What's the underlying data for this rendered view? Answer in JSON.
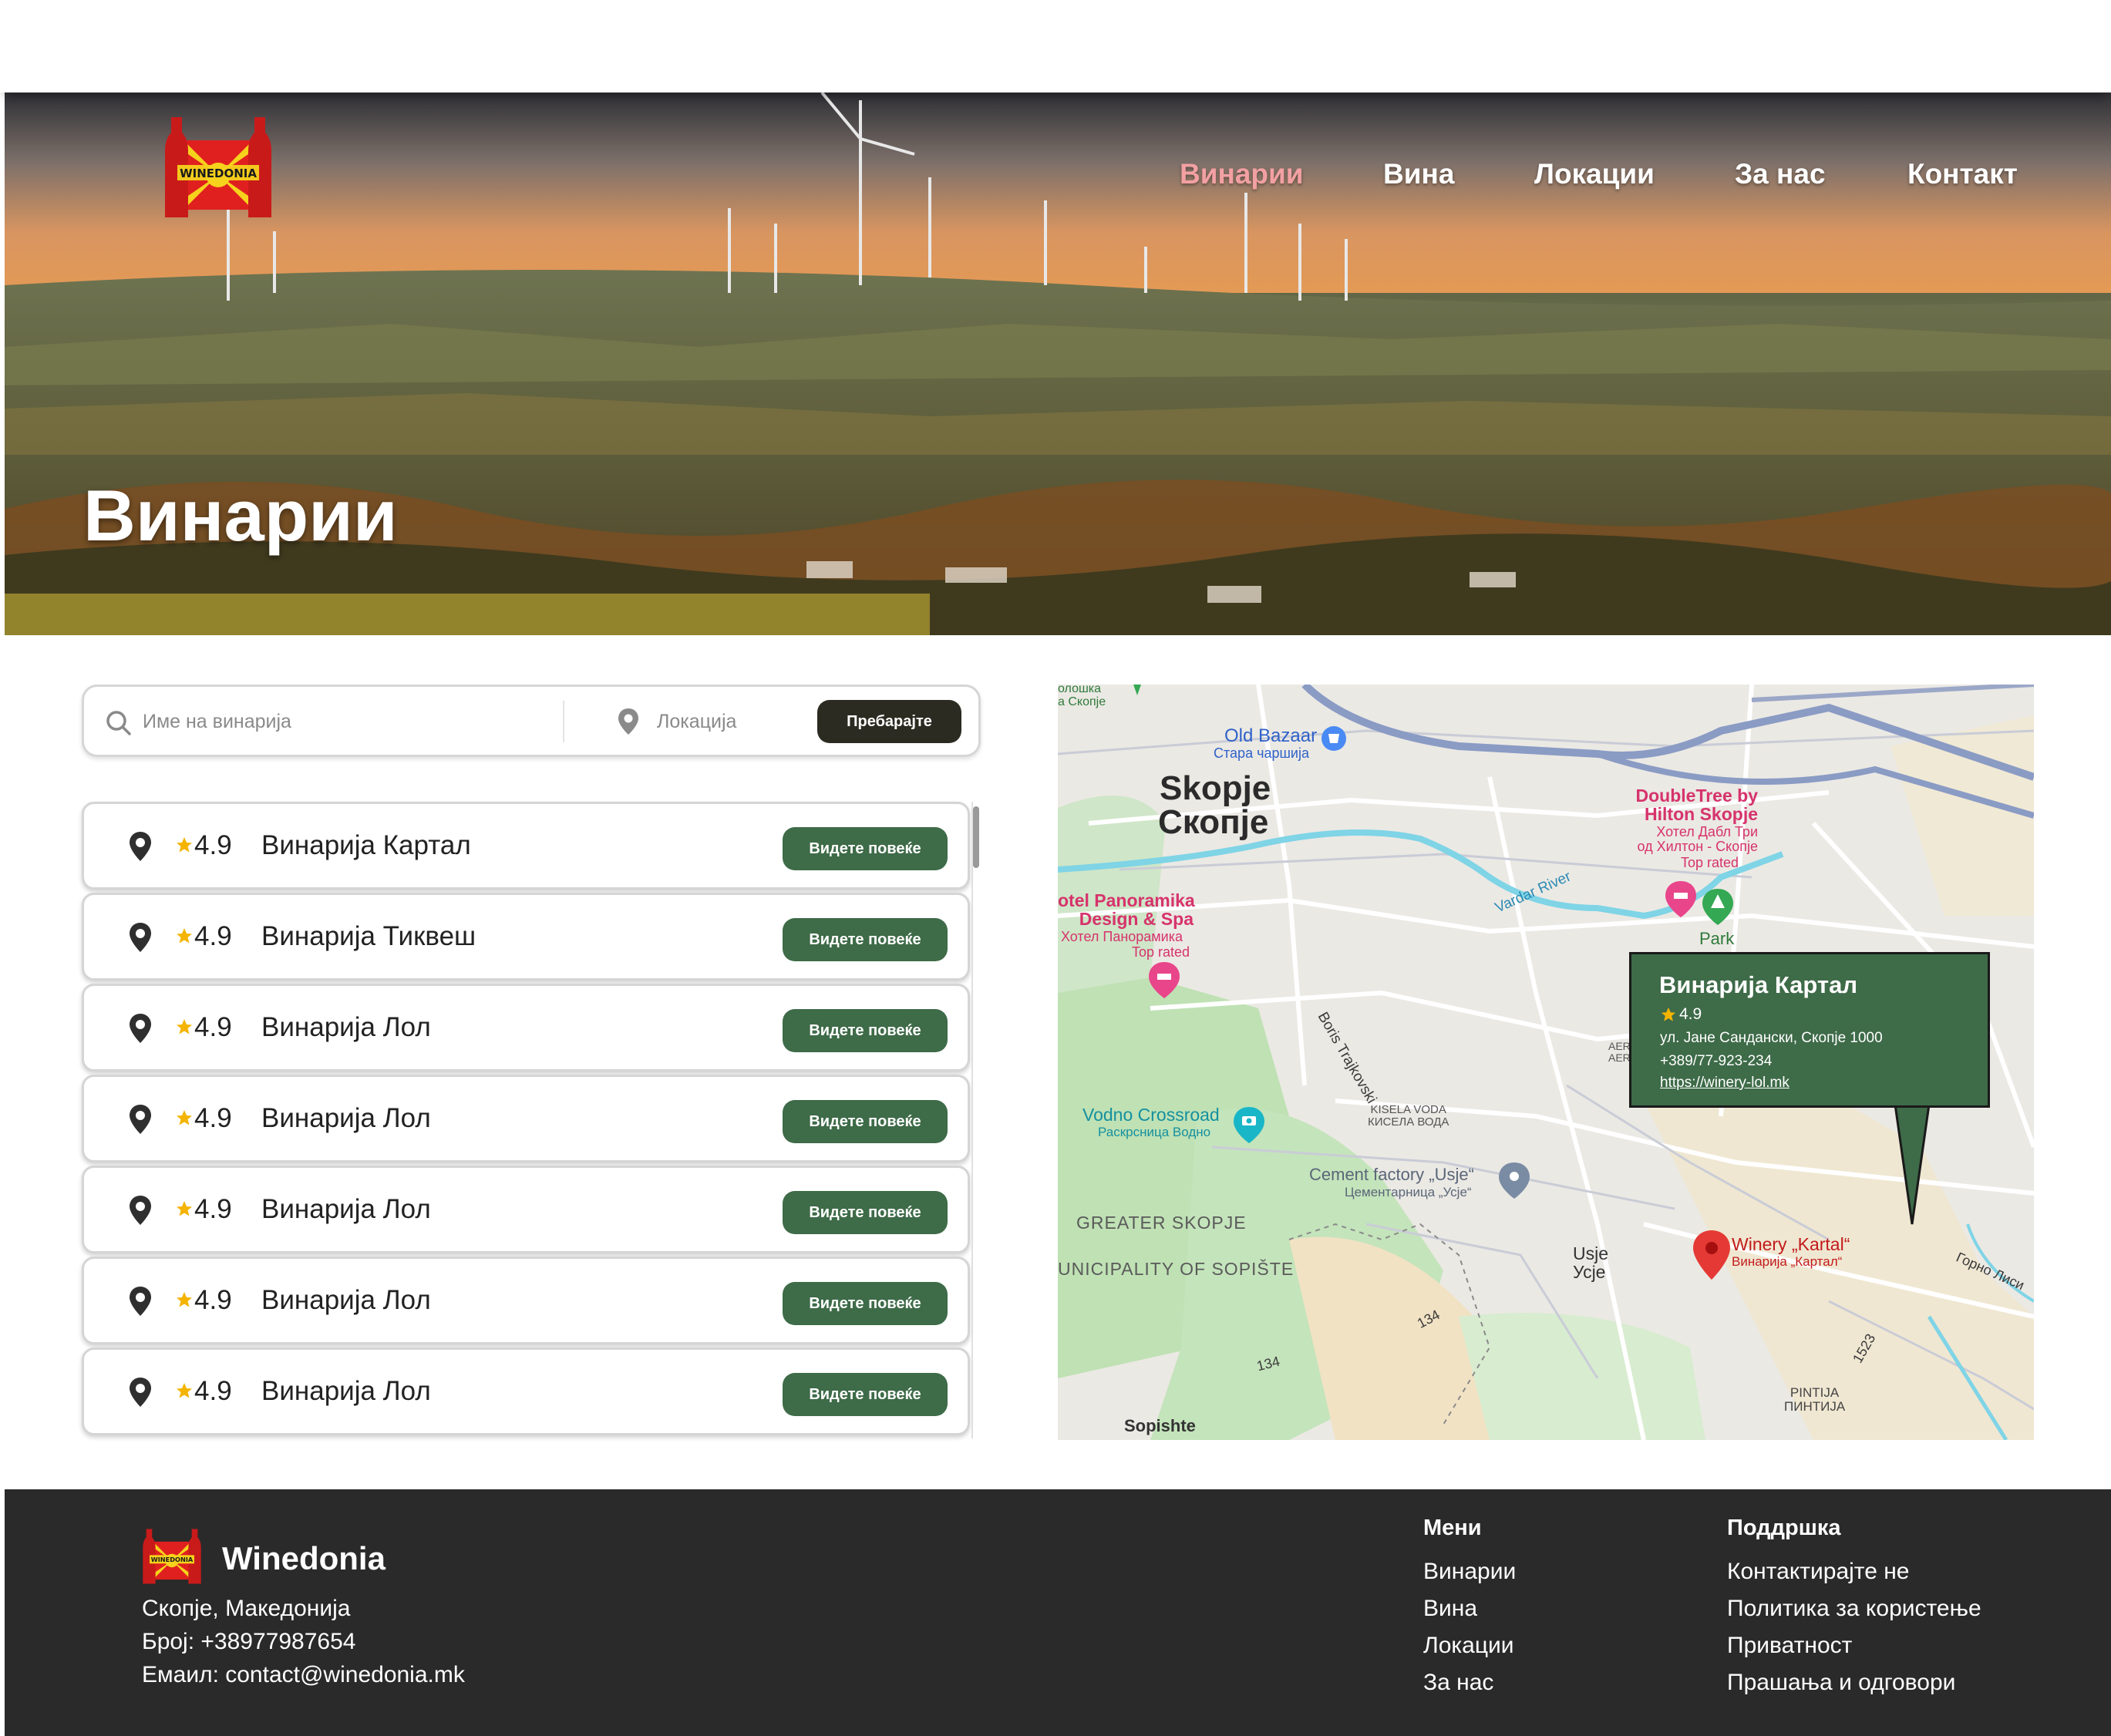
{
  "header": {
    "logo_text": "WINEDONIA",
    "nav": [
      {
        "label": "Винарии",
        "active": true
      },
      {
        "label": "Вина",
        "active": false
      },
      {
        "label": "Локации",
        "active": false
      },
      {
        "label": "За нас",
        "active": false
      },
      {
        "label": "Контакт",
        "active": false
      }
    ],
    "hero_title": "Винарии"
  },
  "search": {
    "name_placeholder": "Име на винарија",
    "location_placeholder": "Локација",
    "button_label": "Пребарајте"
  },
  "wineries": [
    {
      "rating": "4.9",
      "name": "Винарија Картал",
      "button": "Видете повеќе"
    },
    {
      "rating": "4.9",
      "name": "Винарија Тиквеш",
      "button": "Видете повеќе"
    },
    {
      "rating": "4.9",
      "name": "Винарија Лол",
      "button": "Видете повеќе"
    },
    {
      "rating": "4.9",
      "name": "Винарија Лол",
      "button": "Видете повеќе"
    },
    {
      "rating": "4.9",
      "name": "Винарија Лол",
      "button": "Видете повеќе"
    },
    {
      "rating": "4.9",
      "name": "Винарија Лол",
      "button": "Видете повеќе"
    },
    {
      "rating": "4.9",
      "name": "Винарија Лол",
      "button": "Видете повеќе"
    }
  ],
  "map": {
    "labels": {
      "top_left": "олошка\nа Скопје",
      "old_bazaar": "Old Bazaar",
      "old_bazaar_mk": "Стара чаршија",
      "city": "Skopje",
      "city_mk": "Скопје",
      "doubletree": "DoubleTree by\nHilton Skopje",
      "doubletree_mk": "Хотел Дабл Три\nод Хилтон - Скопје",
      "top_rated_1": "Top rated",
      "park": "Park",
      "vardar": "Vardar River",
      "panoramika": "otel Panoramika\nDesign & Spa",
      "panoramika_mk": "Хотел Панорамика",
      "top_rated_2": "Top rated",
      "boris": "Boris Trajkovski",
      "aer": "AER\nAER",
      "kisela": "KISELA VODA\nКИСЕЛА ВОДА",
      "vodno": "Vodno Crossroad",
      "vodno_mk": "Раскрсница Водно",
      "cement": "Cement factory „Usje“",
      "cement_mk": "Цементарница „Усје“",
      "greater": "GREATER SKOPJE",
      "sopiste": "UNICIPALITY OF SOPIŠTE",
      "usje": "Usje\nУсје",
      "kartal": "Winery „Kartal“",
      "kartal_mk": "Винарија „Картал“",
      "gorno": "Горно Лиси",
      "road_134a": "134",
      "road_134b": "134",
      "road_1523": "1523",
      "pintija": "PINTIJA\nПИНТИЈА",
      "sopishte": "Sopishte"
    },
    "popup": {
      "title": "Винарија Картал",
      "rating": "4.9",
      "address": "ул. Јане Сандански, Скопје 1000",
      "phone": "+389/77-923-234",
      "link": "https://winery-lol.mk"
    }
  },
  "footer": {
    "brand": "Winedonia",
    "city": "Скопје, Македонија",
    "phone": "Број: +38977987654",
    "email": "Емаил: contact@winedonia.mk",
    "menu_title": "Мени",
    "menu": [
      "Винарии",
      "Вина",
      "Локации",
      "За нас"
    ],
    "support_title": "Поддршка",
    "support": [
      "Контактирајте не",
      "Политика за користење",
      "Приватност",
      "Прашања и одговори"
    ]
  },
  "colors": {
    "accent_green": "#3e6b48",
    "dark_button": "#2b2b22",
    "active_nav": "#f2a0a2",
    "footer_bg": "#2a2a2a",
    "star": "#f4b400",
    "map_pin": "#e53935"
  },
  "icons": [
    "search-icon",
    "location-pin-icon",
    "star-icon",
    "map-pin-icon",
    "camera-icon",
    "hotel-icon",
    "tree-icon",
    "shopping-icon"
  ]
}
